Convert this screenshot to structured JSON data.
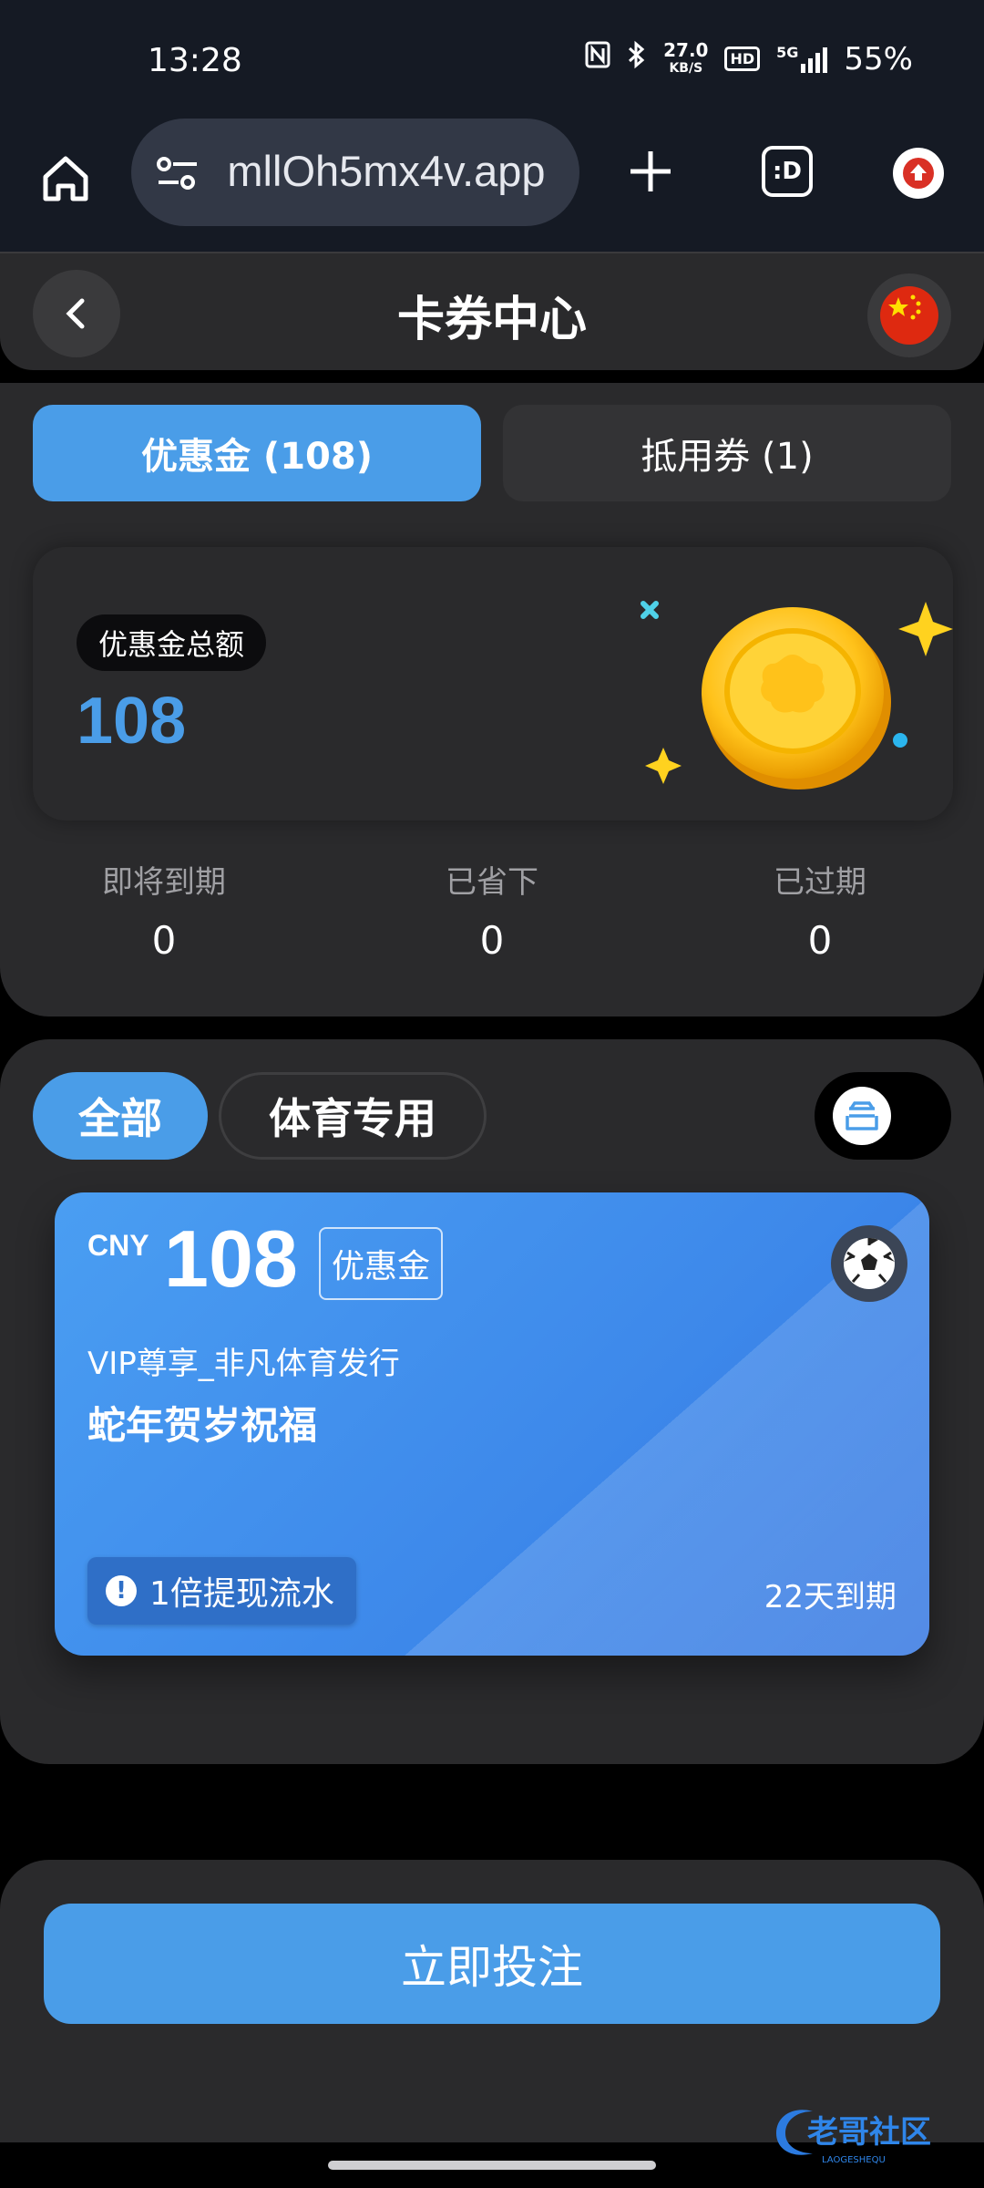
{
  "status_bar": {
    "time": "13:28",
    "net_speed_value": "27.0",
    "net_speed_unit": "KB/S",
    "hd_label": "HD",
    "network_type": "5G",
    "battery": "55%"
  },
  "browser": {
    "url": " mllOh5mx4v.app",
    "tab_switcher_label": ":D"
  },
  "header": {
    "title": "卡券中心"
  },
  "tabs": [
    {
      "label": "优惠金 (108)",
      "active": true
    },
    {
      "label": "抵用券 (1)",
      "active": false
    }
  ],
  "summary": {
    "total_label": "优惠金总额",
    "total_value": "108",
    "stats": [
      {
        "label": "即将到期",
        "value": "0"
      },
      {
        "label": "已省下",
        "value": "0"
      },
      {
        "label": "已过期",
        "value": "0"
      }
    ]
  },
  "filters": {
    "all": "全部",
    "sports": "体育专用"
  },
  "coupon": {
    "currency": "CNY",
    "amount": "108",
    "type_tag": "优惠金",
    "issuer": "VIP尊享_非凡体育发行",
    "title": "蛇年贺岁祝福",
    "wager_requirement": "1倍提现流水",
    "expiry": "22天到期"
  },
  "actions": {
    "bet_now": "立即投注"
  },
  "watermark": {
    "text": "老哥社区",
    "subtext": "LAOGESHEQU"
  },
  "colors": {
    "accent": "#4a9de8",
    "card_bg": "#2a2a2c",
    "page_bg": "#000000",
    "browser_bg": "#151a24"
  }
}
